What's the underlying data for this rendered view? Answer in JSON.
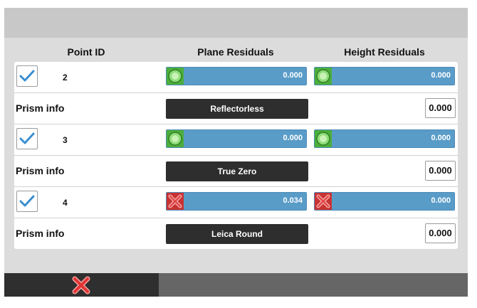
{
  "header": {
    "point_id": "Point ID",
    "plane_residuals": "Plane Residuals",
    "height_residuals": "Height Residuals"
  },
  "points": [
    {
      "checked": true,
      "id": "2",
      "plane_status": "ok",
      "plane_value": "0.000",
      "height_status": "ok",
      "height_value": "0.000",
      "prism_label": "Prism info",
      "prism_type": "Reflectorless",
      "height_input": "0.000"
    },
    {
      "checked": true,
      "id": "3",
      "plane_status": "ok",
      "plane_value": "0.000",
      "height_status": "ok",
      "height_value": "0.000",
      "prism_label": "Prism info",
      "prism_type": "True Zero",
      "height_input": "0.000"
    },
    {
      "checked": true,
      "id": "4",
      "plane_status": "error",
      "plane_value": "0.034",
      "height_status": "error",
      "height_value": "0.000",
      "prism_label": "Prism info",
      "prism_type": "Leica Round",
      "height_input": "0.000"
    }
  ],
  "icons": {
    "ok": "green-ok-icon",
    "error": "red-x-icon",
    "cancel": "cancel-x-icon",
    "checkmark": "checkmark-icon"
  },
  "colors": {
    "bar": "#5a9cc8",
    "ok": "#3fae3f",
    "error": "#d83a3a",
    "check": "#3a8ed0",
    "button": "#2e2e2e"
  }
}
